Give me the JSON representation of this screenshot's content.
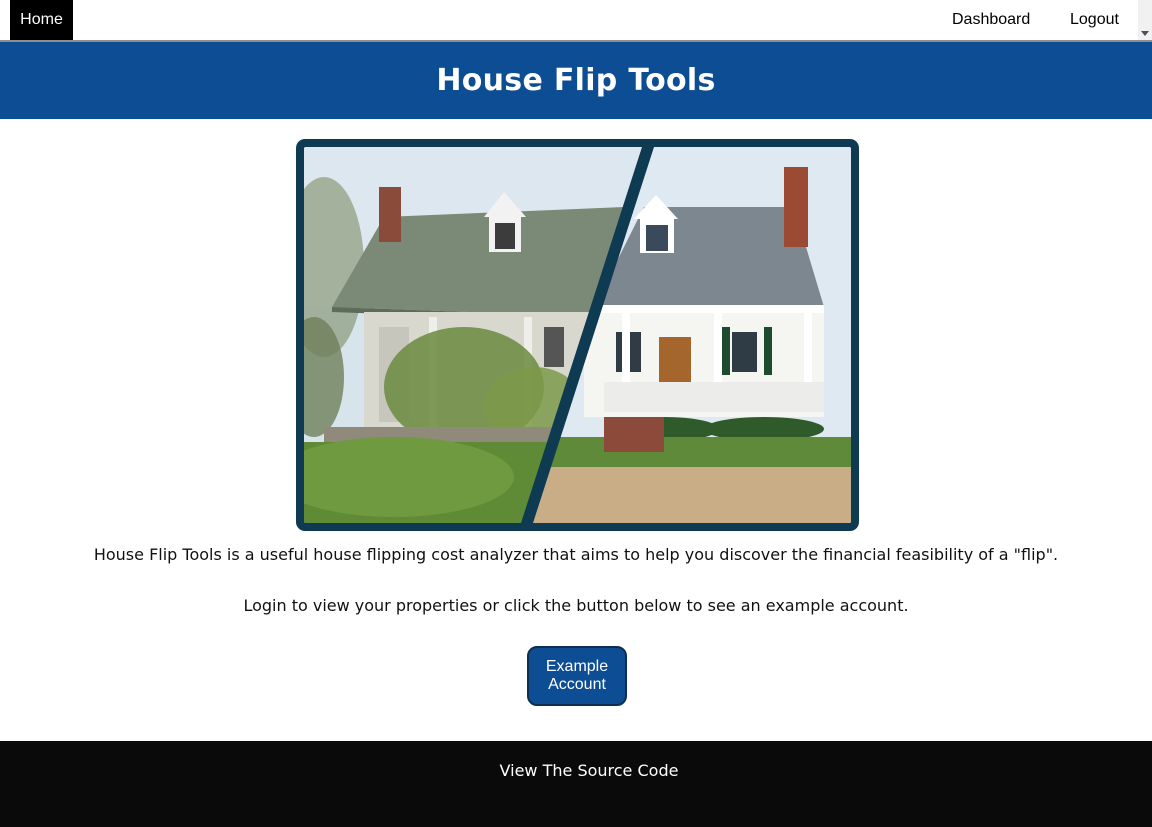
{
  "nav": {
    "home_label": "Home",
    "dashboard_label": "Dashboard",
    "logout_label": "Logout"
  },
  "banner": {
    "title": "House Flip Tools"
  },
  "main": {
    "description": "House Flip Tools is a useful house flipping cost analyzer that aims to help you discover the financial feasibility of a \"flip\".",
    "login_text": "Login to view your properties or click the button below to see an example account.",
    "example_button": {
      "line1": "Example",
      "line2": "Account"
    }
  },
  "footer": {
    "source_link": "View The Source Code"
  },
  "colors": {
    "banner": "#0d4d93",
    "button": "#0d4d93",
    "frame": "#0e3a52",
    "footer": "#0a0a0a"
  }
}
